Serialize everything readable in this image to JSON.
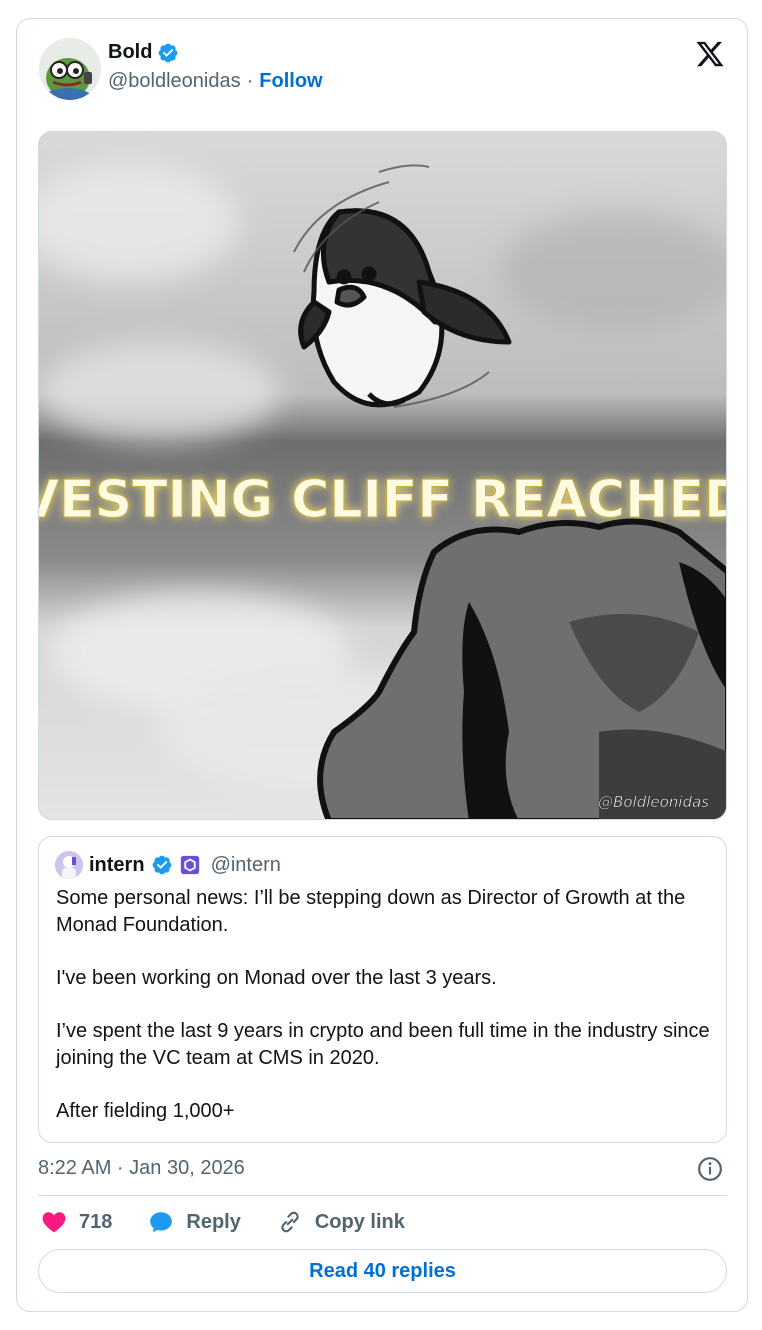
{
  "author": {
    "name": "Bold",
    "handle": "@boldleonidas",
    "separator": "·",
    "follow_label": "Follow"
  },
  "media": {
    "caption_text": "VESTING CLIFF REACHED",
    "signature": "@Boldleonidas"
  },
  "quote": {
    "name": "intern",
    "handle": "@intern",
    "paragraphs": [
      "Some personal news: I’ll be stepping down as Director of Growth at the Monad Foundation.",
      "I've been working on Monad over the last 3 years.",
      "I’ve spent the last 9 years in crypto and been full time in the industry since joining the VC team at CMS in 2020.",
      "After fielding 1,000+"
    ]
  },
  "timestamp": "8:22 AM · Jan 30, 2026",
  "actions": {
    "likes": "718",
    "reply_label": "Reply",
    "copy_label": "Copy link"
  },
  "read_replies_label": "Read 40 replies",
  "colors": {
    "link_blue": "#006fd6",
    "verified_blue": "#1d9bf0",
    "like_pink": "#f91880",
    "muted": "#536471"
  }
}
